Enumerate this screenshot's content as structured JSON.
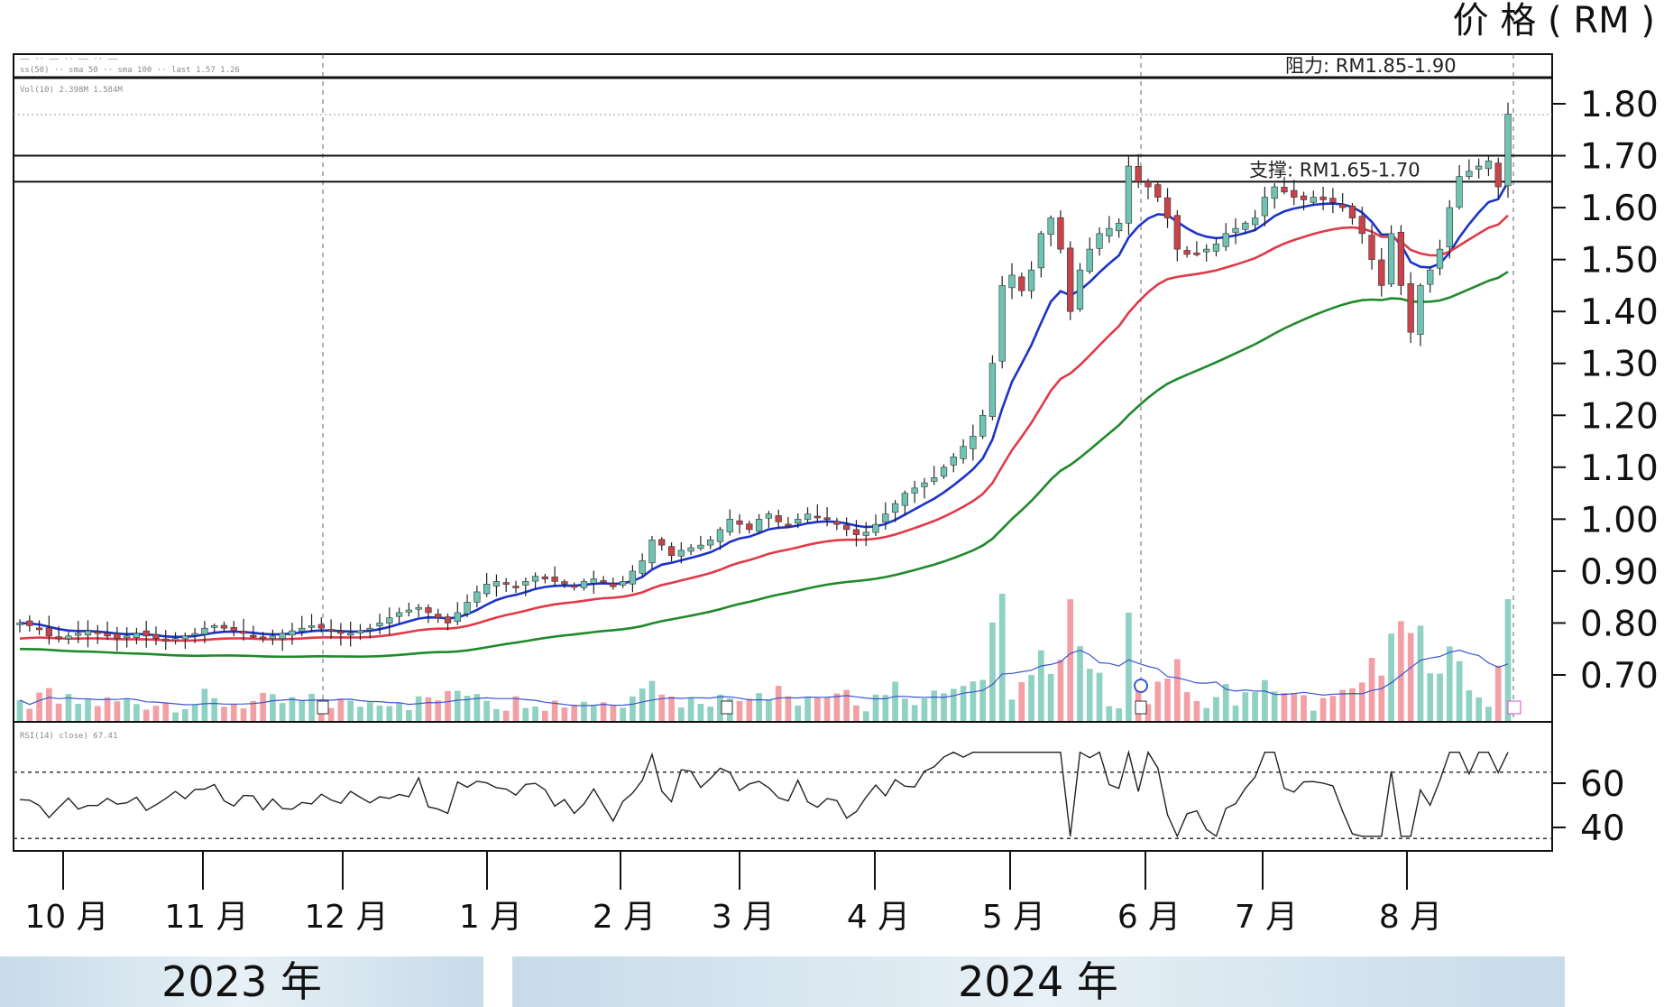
{
  "chart_data": {
    "type": "candlestick",
    "unit_label": "价 格 ( RM )",
    "y_ticks": [
      "1.80",
      "1.70",
      "1.60",
      "1.50",
      "1.40",
      "1.30",
      "1.20",
      "1.10",
      "1.00",
      "0.90",
      "0.80",
      "0.70"
    ],
    "y_tick_values": [
      1.8,
      1.7,
      1.6,
      1.5,
      1.4,
      1.3,
      1.2,
      1.1,
      1.0,
      0.9,
      0.8,
      0.7
    ],
    "ylim": [
      0.68,
      1.83
    ],
    "rsi_ticks": [
      "60",
      "40"
    ],
    "rsi_tick_values": [
      60,
      40
    ],
    "rsi_range": [
      33,
      75
    ],
    "rsi_guides": [
      65,
      35
    ],
    "months": [
      "10 月",
      "11 月",
      "12 月",
      "1 月",
      "2 月",
      "3 月",
      "4 月",
      "5 月",
      "6 月",
      "7 月",
      "8 月"
    ],
    "years": [
      "2023 年",
      "2024 年"
    ],
    "annotations": {
      "resistance": {
        "text": "阻力: RM1.85-1.90"
      },
      "support": {
        "text": "支撑: RM1.65-1.70",
        "low": 1.65,
        "high": 1.7
      }
    },
    "indicator_headers": {
      "price": "—— ·· —— ·· —— ·· ——",
      "ma": "ss(50) ·· sma 50 ·· sma 100 ·· last 1.57 1.26",
      "volume": "Vol(10) 2.398M 1.584M",
      "rsi": "RSI(14) close) 67.41"
    },
    "colors": {
      "up": "#6fc3b2",
      "down": "#c8444a",
      "wick": "#222222",
      "ma_short": "#1b33c9",
      "ma_mid": "#e03a48",
      "ma_long": "#1f8a2a",
      "vol_up": "#8fd1c2",
      "vol_down": "#f2a0a6",
      "vol_ma": "#3a55d0",
      "rsi": "#222222",
      "year_band": "#dce9f2"
    },
    "series": {
      "close": [
        0.8,
        0.795,
        0.79,
        0.775,
        0.77,
        0.775,
        0.78,
        0.785,
        0.78,
        0.775,
        0.77,
        0.775,
        0.78,
        0.775,
        0.77,
        0.765,
        0.77,
        0.775,
        0.78,
        0.79,
        0.795,
        0.79,
        0.785,
        0.78,
        0.775,
        0.77,
        0.775,
        0.78,
        0.785,
        0.79,
        0.795,
        0.79,
        0.785,
        0.78,
        0.78,
        0.785,
        0.79,
        0.8,
        0.81,
        0.82,
        0.825,
        0.83,
        0.82,
        0.81,
        0.8,
        0.82,
        0.84,
        0.86,
        0.875,
        0.88,
        0.875,
        0.87,
        0.88,
        0.89,
        0.885,
        0.88,
        0.875,
        0.87,
        0.88,
        0.885,
        0.88,
        0.87,
        0.88,
        0.9,
        0.92,
        0.96,
        0.95,
        0.93,
        0.94,
        0.945,
        0.95,
        0.96,
        0.98,
        1.0,
        0.99,
        0.98,
        1.0,
        1.01,
        0.995,
        0.99,
        1.0,
        1.01,
        1.005,
        1.0,
        0.99,
        0.98,
        0.97,
        0.975,
        0.99,
        1.01,
        1.03,
        1.05,
        1.06,
        1.07,
        1.08,
        1.1,
        1.12,
        1.14,
        1.16,
        1.2,
        1.3,
        1.45,
        1.47,
        1.44,
        1.48,
        1.55,
        1.58,
        1.52,
        1.4,
        1.48,
        1.52,
        1.55,
        1.56,
        1.57,
        1.68,
        1.65,
        1.64,
        1.62,
        1.58,
        1.52,
        1.51,
        1.51,
        1.52,
        1.53,
        1.55,
        1.56,
        1.57,
        1.58,
        1.62,
        1.64,
        1.63,
        1.62,
        1.615,
        1.62,
        1.615,
        1.61,
        1.6,
        1.58,
        1.55,
        1.5,
        1.45,
        1.55,
        1.45,
        1.36,
        1.45,
        1.48,
        1.52,
        1.6,
        1.66,
        1.67,
        1.68,
        1.69,
        1.64,
        1.78
      ]
    }
  }
}
